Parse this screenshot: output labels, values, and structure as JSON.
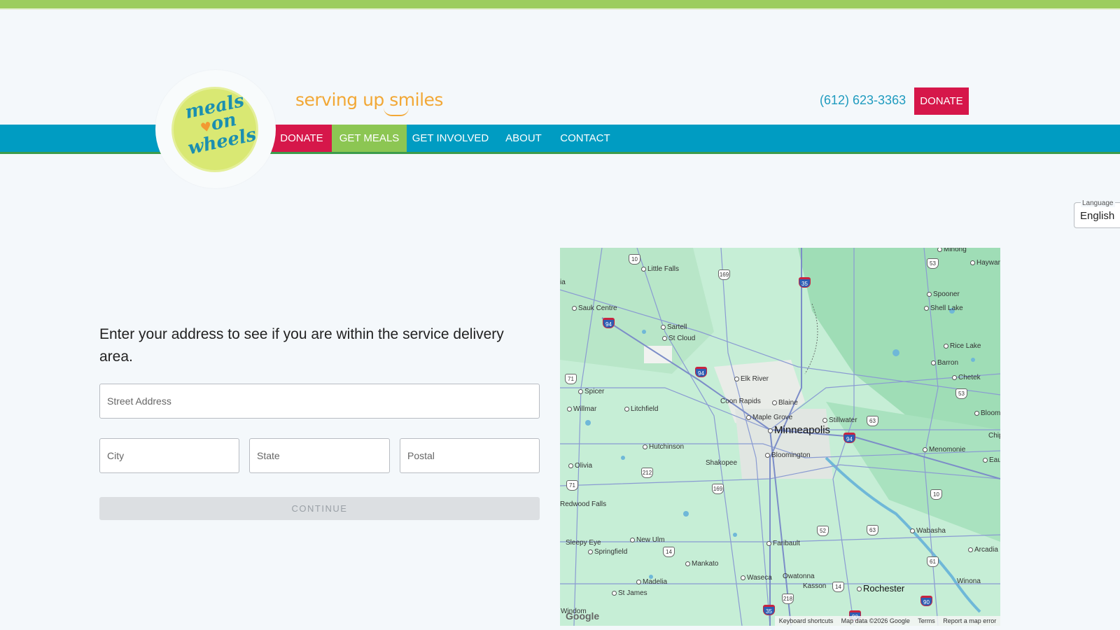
{
  "header": {
    "tagline": "serving up smiles",
    "phone": "(612) 623-3363",
    "donate_label": "DONATE",
    "logo_text": [
      "meals",
      "on",
      "wheels"
    ]
  },
  "nav": {
    "items": [
      {
        "label": "DONATE"
      },
      {
        "label": "GET MEALS"
      },
      {
        "label": "GET INVOLVED"
      },
      {
        "label": "ABOUT"
      },
      {
        "label": "CONTACT"
      }
    ]
  },
  "language": {
    "label": "Language",
    "value": "English"
  },
  "form": {
    "intro": "Enter your address to see if you are within the service delivery area.",
    "street_placeholder": "Street Address",
    "city_placeholder": "City",
    "state_placeholder": "State",
    "postal_placeholder": "Postal",
    "continue_label": "CONTINUE"
  },
  "map": {
    "places": [
      "Minong",
      "Hayward",
      "Little Falls",
      "ia",
      "Spooner",
      "Sauk Centre",
      "Shell Lake",
      "Sartell",
      "St Cloud",
      "Rice Lake",
      "Barron",
      "Elk River",
      "Chetek",
      "Spicer",
      "Coon Rapids",
      "Blaine",
      "Willmar",
      "Litchfield",
      "Maple Grove",
      "Stillwater",
      "Bloomer",
      "Minneapolis",
      "Chip",
      "Hutchinson",
      "Menomonie",
      "Bloomington",
      "Shakopee",
      "Eau Cla",
      "Olivia",
      "Redwood Falls",
      "Wabasha",
      "Sleepy Eye",
      "New Ulm",
      "Faribault",
      "Arcadia",
      "Springfield",
      "Mankato",
      "Waseca",
      "Owatonna",
      "Madelia",
      "Kasson",
      "Rochester",
      "Winona",
      "St James",
      "Windom"
    ],
    "highways": [
      "10",
      "169",
      "35",
      "53",
      "94",
      "94",
      "71",
      "63",
      "53",
      "212",
      "169",
      "71",
      "10",
      "94",
      "52",
      "63",
      "14",
      "61",
      "14",
      "218",
      "35",
      "90",
      "90"
    ],
    "google_logo": "Google",
    "footer": [
      "Keyboard shortcuts",
      "Map data ©2026 Google",
      "Terms",
      "Report a map error"
    ]
  },
  "colors": {
    "brand_blue": "#009cc2",
    "brand_green": "#8cc653",
    "brand_red": "#d6174a",
    "tagline_orange": "#f2a836"
  }
}
